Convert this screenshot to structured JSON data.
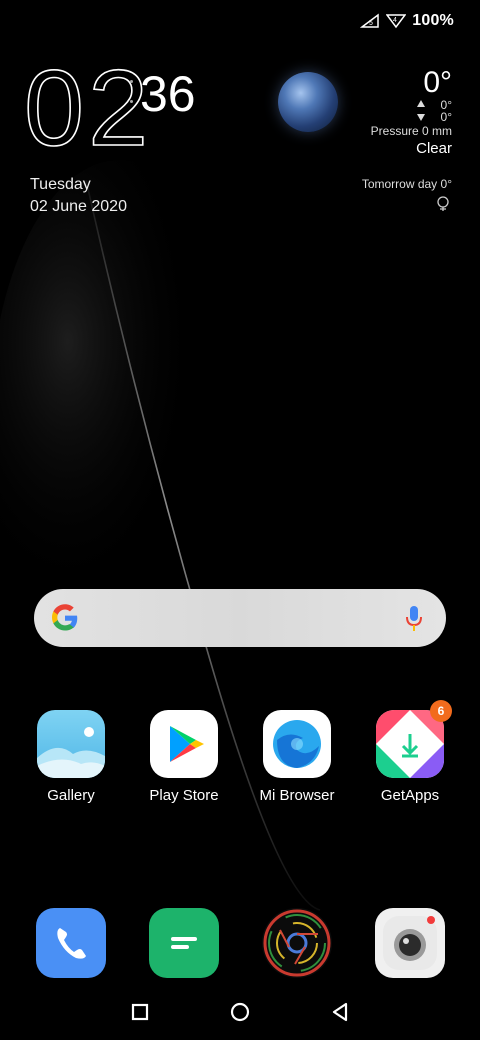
{
  "status_bar": {
    "battery": "100%",
    "icons": [
      "signal-icon",
      "signal-icon",
      "battery-icon"
    ]
  },
  "clock": {
    "hours": "02",
    "minutes": "36",
    "day": "Tuesday",
    "date": "02 June 2020"
  },
  "weather": {
    "temperature": "0°",
    "high": "0°",
    "low": "0°",
    "pressure": "Pressure 0 mm",
    "condition": "Clear",
    "tomorrow": "Tomorrow day 0°"
  },
  "search": {
    "icons": [
      "google-logo",
      "mic-icon"
    ]
  },
  "apps": [
    {
      "label": "Gallery",
      "icon": "gallery-icon"
    },
    {
      "label": "Play Store",
      "icon": "play-store-icon"
    },
    {
      "label": "Mi Browser",
      "icon": "mi-browser-icon"
    },
    {
      "label": "GetApps",
      "icon": "getapps-icon",
      "badge": "6"
    }
  ],
  "dock": [
    {
      "icon": "phone-icon"
    },
    {
      "icon": "messages-icon"
    },
    {
      "icon": "chrome-icon"
    },
    {
      "icon": "camera-icon"
    }
  ],
  "nav": [
    "recents-button",
    "home-button",
    "back-button"
  ],
  "colors": {
    "background": "#000000",
    "badge": "#f26b1d",
    "phone": "#4a90f5",
    "messages": "#1db36b"
  }
}
